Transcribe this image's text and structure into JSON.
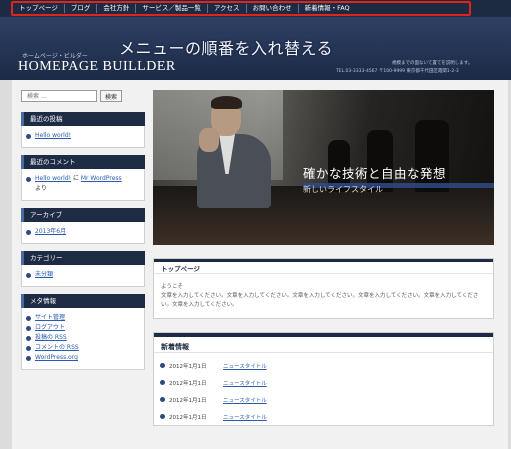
{
  "nav": {
    "items": [
      "トップページ",
      "ブログ",
      "会社方針",
      "サービス／製品一覧",
      "アクセス",
      "お問い合わせ",
      "新着情報・FAQ"
    ]
  },
  "annotation": "メニューの順番を入れ替える",
  "header": {
    "subtitle": "ホームページ・ビルダー",
    "title": "HOMEPAGE BUILLDER",
    "description": "規模までの面ないて置てを説明します。",
    "tel": "TEL.03-3333-4567 〒100-9999 東京都千代田区霞関1-2-3"
  },
  "sidebar": {
    "search_placeholder": "検索 …",
    "search_button": "検索",
    "widgets": [
      {
        "title": "最近の投稿",
        "items": [
          {
            "link": "Hello world!"
          }
        ]
      },
      {
        "title": "最近のコメント",
        "items": [
          {
            "link": "Hello world!",
            "middle": " に ",
            "link2": "Mr WordPress",
            "after": " より"
          }
        ]
      },
      {
        "title": "アーカイブ",
        "items": [
          {
            "link": "2013年6月"
          }
        ]
      },
      {
        "title": "カテゴリー",
        "items": [
          {
            "link": "未分類"
          }
        ]
      },
      {
        "title": "メタ情報",
        "items": [
          {
            "link": "サイト管理"
          },
          {
            "link": "ログアウト"
          },
          {
            "link": "投稿の RSS"
          },
          {
            "link": "コメントの RSS"
          },
          {
            "link": "WordPress.org"
          }
        ]
      }
    ]
  },
  "hero": {
    "title": "確かな技術と自由な発想",
    "subtitle": "新しいライフスタイル"
  },
  "intro": {
    "title": "トップページ",
    "greeting": "ようこそ",
    "text": "文章を入力してください。文章を入力してください。文章を入力してください。文章を入力してください。文章を入力してください。文章を入力してください。"
  },
  "news": {
    "title": "新着情報",
    "rows": [
      {
        "date": "2012年1月1日",
        "link": "ニュースタイトル"
      },
      {
        "date": "2012年1月1日",
        "link": "ニュースタイトル"
      },
      {
        "date": "2012年1月1日",
        "link": "ニュースタイトル"
      },
      {
        "date": "2012年1月1日",
        "link": "ニュースタイトル"
      }
    ]
  },
  "colors": {
    "nav_bg": "#1c2a42",
    "highlight_frame": "#e0241c",
    "widget_title_bg": "#1d2b45",
    "link": "#2a5ab0"
  }
}
